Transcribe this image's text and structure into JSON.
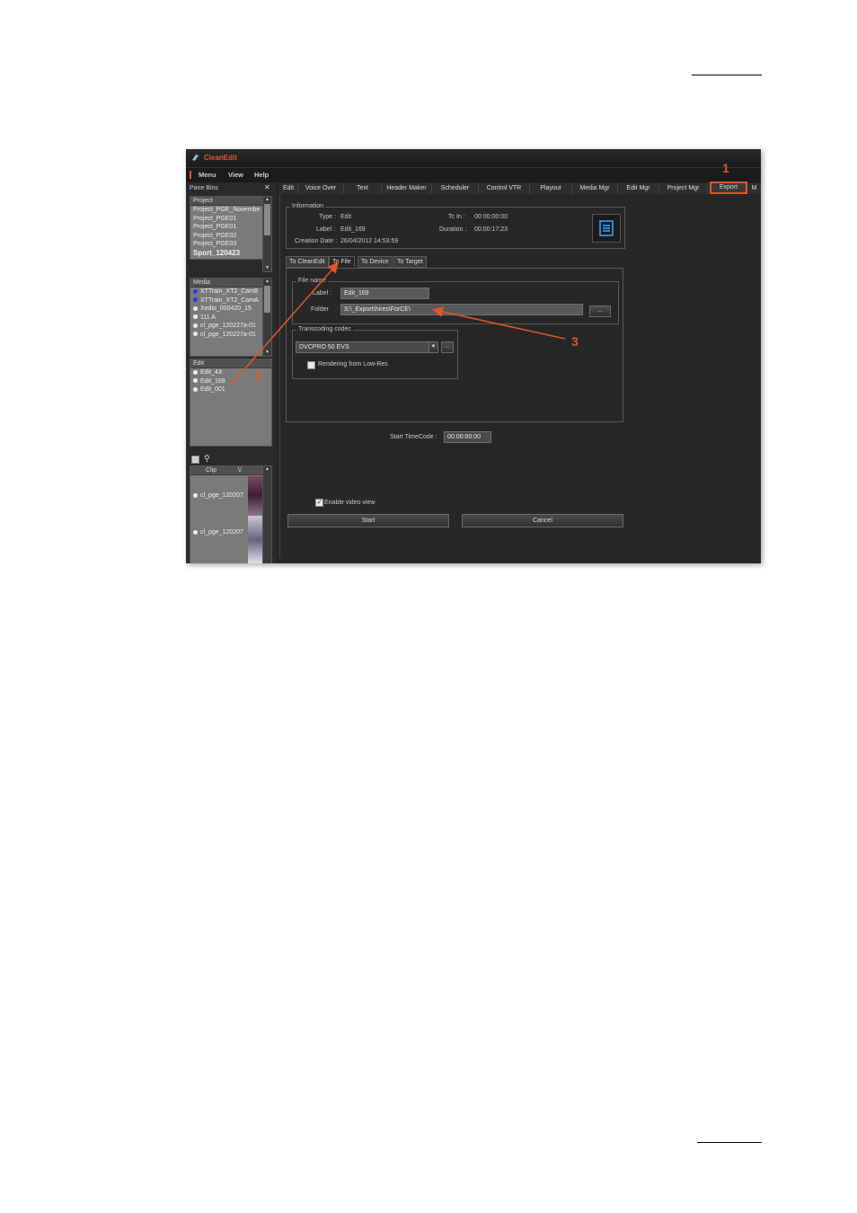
{
  "app": {
    "title": "CleanEdit"
  },
  "menu": {
    "items": [
      "Menu",
      "View",
      "Help"
    ]
  },
  "left_pane": {
    "title": "Pane Bins",
    "close": "✕",
    "project": {
      "header": "Project",
      "items": [
        "Project_PGE_Novembe",
        "Project_PGE01",
        "Project_PGE01",
        "Project_PGE02",
        "Project_PGE03",
        "Sport_120423"
      ]
    },
    "media": {
      "header": "Media",
      "items": [
        "XTTrain_XT2_Cam8",
        "XTTrain_XT2_CamA",
        "Xedio_000420_15",
        "111 A",
        "cl_pge_120227a-01",
        "cl_pge_120227a-01"
      ]
    },
    "edit": {
      "header": "Edit",
      "items": [
        "Edit_43",
        "Edit_169",
        "Edit_001"
      ]
    },
    "clip": {
      "header": "Clip",
      "sort": "\\/",
      "items": [
        "cl_pge_120207",
        "cl_pge_120207"
      ]
    }
  },
  "tabs": [
    "Edit",
    "Voice Over",
    "Text",
    "Header Maker",
    "Scheduler",
    "Control VTR",
    "Playout",
    "Media Mgr",
    "Edit Mgr",
    "Project Mgr",
    "Export",
    "M"
  ],
  "information": {
    "title": "Information",
    "type_label": "Type :",
    "type_value": "Edit",
    "label_label": "Label :",
    "label_value": "Edit_169",
    "creation_label": "Creation Date :",
    "creation_value": "26/04/2012 14:53:59",
    "tcin_label": "Tc In :",
    "tcin_value": "00:00:00:00",
    "duration_label": "Duration :",
    "duration_value": "00:00:17:23"
  },
  "subtabs": [
    "To CleanEdit",
    "To File",
    "To Device",
    "To Target"
  ],
  "file_name": {
    "title": "File name",
    "label_label": "Label :",
    "label_value": "Edit_169",
    "folder_label": "Folder",
    "folder_value": "S:\\_Export\\hires\\ForCE\\",
    "browse": "..."
  },
  "transcoding": {
    "title": "Transcoding codec",
    "codec": "DVCPRO 50 EVS",
    "more": "...",
    "render_lowres": "Rendering from Low-Res"
  },
  "start_timecode": {
    "label": "Start TimeCode :",
    "value": "00:00:00:00"
  },
  "enable_video_view": "Enable video view",
  "buttons": {
    "start": "Start",
    "cancel": "Cancel"
  },
  "callouts": [
    "1",
    "2",
    "3"
  ],
  "colors": {
    "accent": "#e2562b",
    "background": "#262626"
  }
}
